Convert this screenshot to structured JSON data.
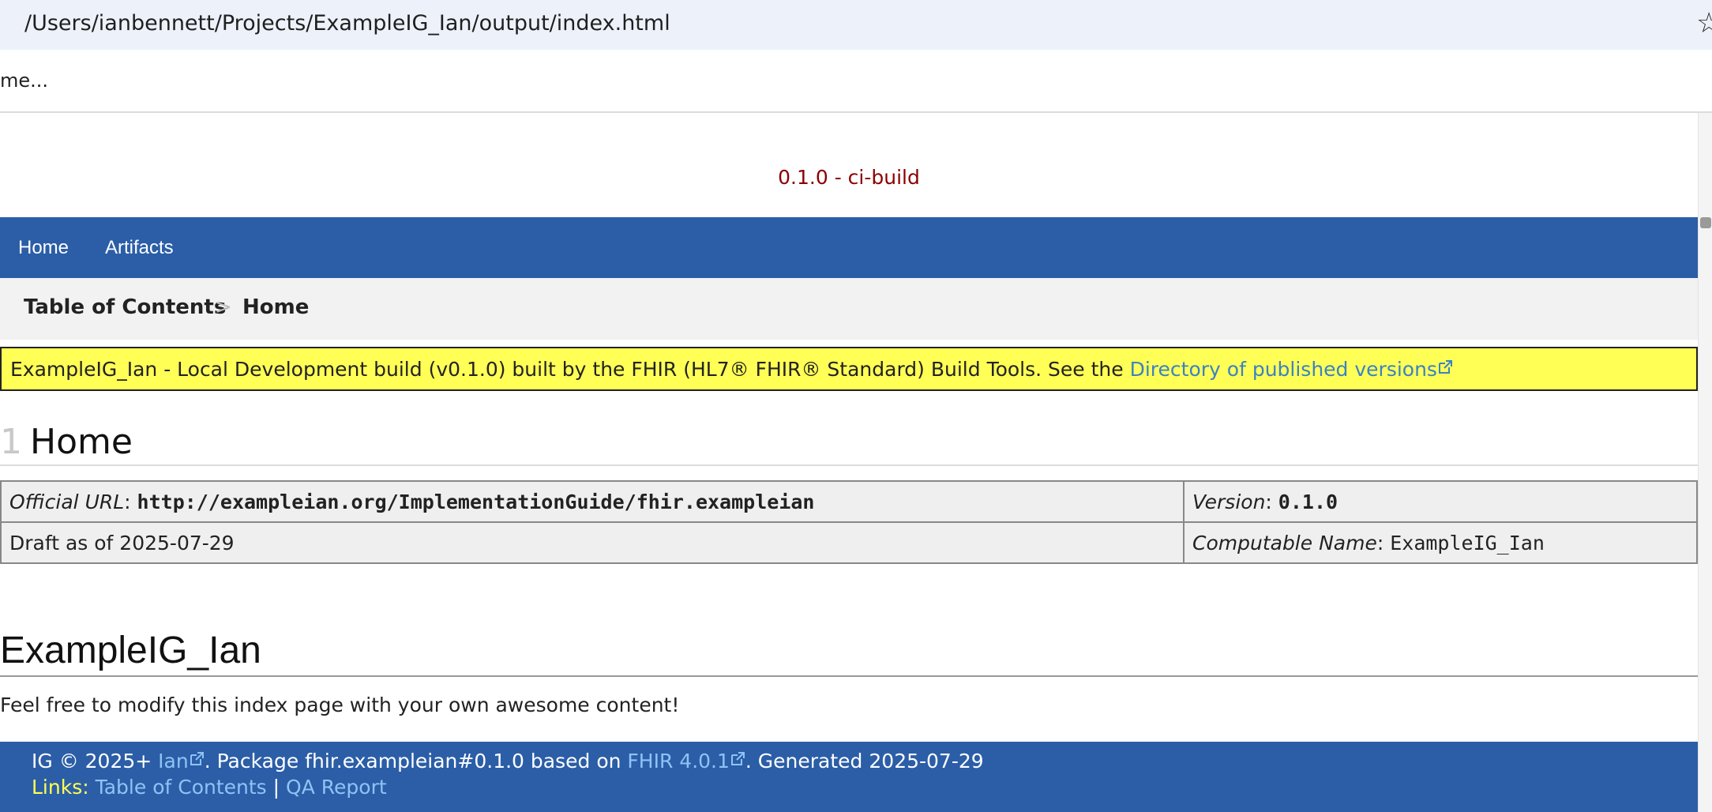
{
  "browser": {
    "address": "/Users/ianbennett/Projects/ExampleIG_Ian/output/index.html",
    "find_text": "me..."
  },
  "header": {
    "version_line": "0.1.0 - ci-build"
  },
  "nav": {
    "items": [
      {
        "label": "Home"
      },
      {
        "label": "Artifacts"
      }
    ]
  },
  "breadcrumb": {
    "items": [
      "Table of Contents",
      "Home"
    ],
    "separator": ">"
  },
  "banner": {
    "text": "ExampleIG_Ian - Local Development build (v0.1.0) built by the FHIR (HL7® FHIR® Standard) Build Tools. See the ",
    "link": "Directory of published versions"
  },
  "page": {
    "section_number": "1",
    "title": "Home"
  },
  "meta_table": {
    "official_url_label": "Official URL",
    "official_url": "http://exampleian.org/ImplementationGuide/fhir.exampleian",
    "version_label": "Version",
    "version": "0.1.0",
    "status": "Draft as of 2025-07-29",
    "computable_name_label": "Computable Name",
    "computable_name": "ExampleIG_Ian"
  },
  "content": {
    "heading": "ExampleIG_Ian",
    "paragraph": "Feel free to modify this index page with your own awesome content!"
  },
  "footer": {
    "ig_prefix": "IG © 2025+ ",
    "author_link": "Ian",
    "package_text": ". Package fhir.exampleian#0.1.0 based on ",
    "fhir_link": "FHIR 4.0.1",
    "generated_text": ". Generated 2025-07-29",
    "links_label": "Links:",
    "toc_link": "Table of Contents",
    "divider": "|",
    "qa_link": "QA Report"
  },
  "colors": {
    "nav_bg": "#2b5ea7",
    "banner_bg": "#ffff55",
    "link": "#3b82c4",
    "version_text": "#8b0000"
  }
}
